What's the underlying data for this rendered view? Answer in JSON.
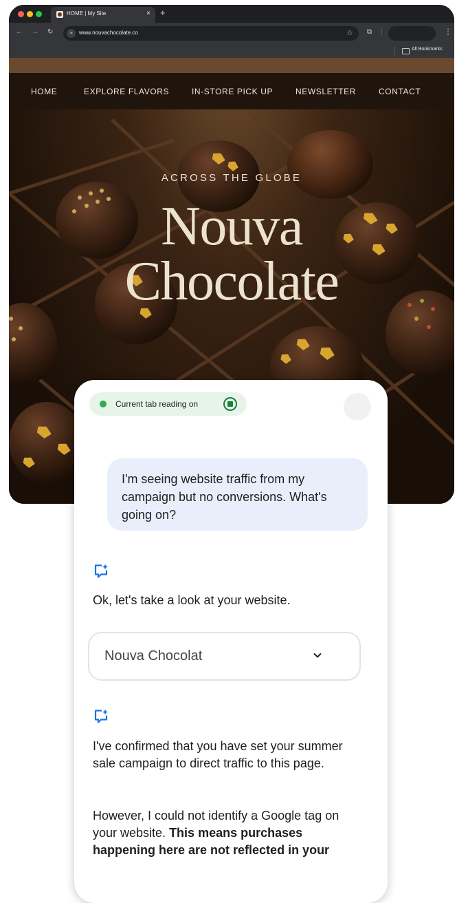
{
  "browser": {
    "tab_title": "HOME | My Site",
    "tab_close": "×",
    "new_tab": "+",
    "url": "www.nouvachocolate.co",
    "bookmarks_label": "All Bookmarks"
  },
  "site": {
    "nav": [
      "HOME",
      "EXPLORE FLAVORS",
      "IN-STORE PICK UP",
      "NEWSLETTER",
      "CONTACT"
    ],
    "eyebrow": "ACROSS THE GLOBE",
    "brand_line1": "Nouva",
    "brand_line2": "Chocolate"
  },
  "assistant": {
    "status_chip": "Current tab reading on",
    "user_message": "I'm seeing website traffic from my campaign but no conversions. What's going on?",
    "reply1": "Ok, let's take a look at your website.",
    "select_value": "Nouva Chocolat",
    "reply2_p1": "I've confirmed that you have set your summer sale campaign to direct traffic to this page.",
    "reply2_p2_plain": "However, I could not identify a Google tag on your website. ",
    "reply2_p2_bold": "This means purchases happening here are not reflected in your"
  },
  "colors": {
    "chip_bg": "#e6f4ea",
    "status_green": "#188038",
    "bubble_bg": "#e8effb",
    "spark_blue": "#1a73e8"
  }
}
